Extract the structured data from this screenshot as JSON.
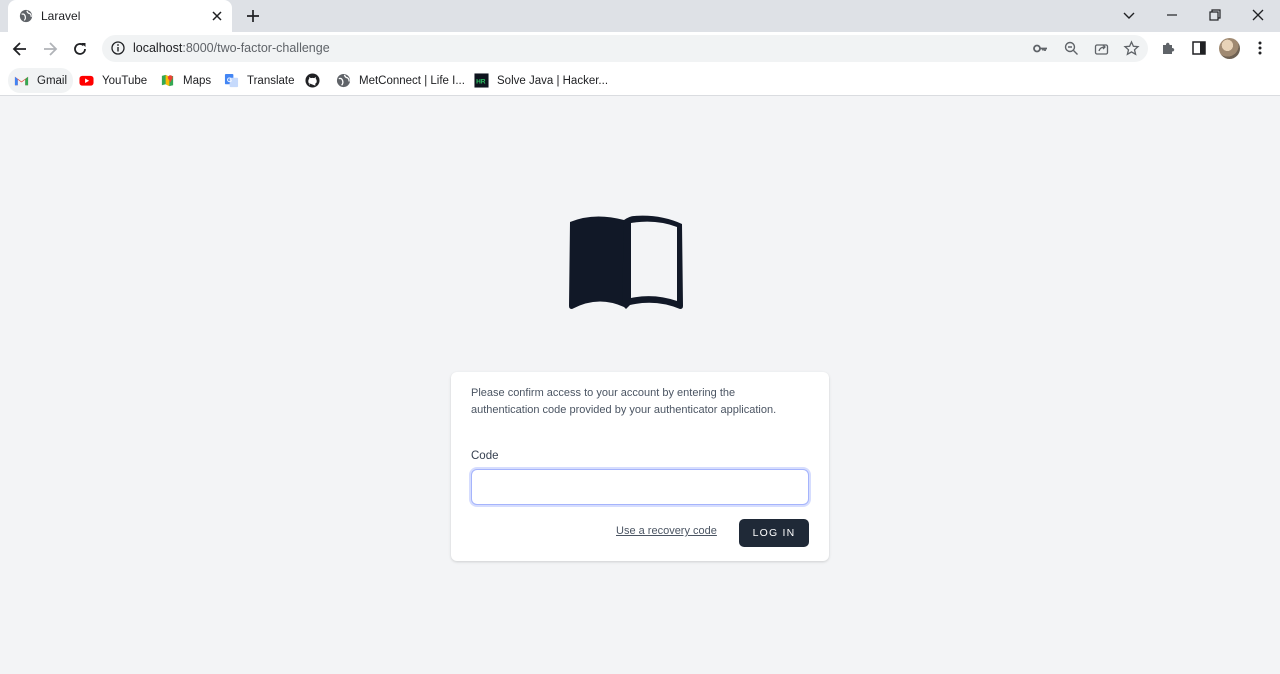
{
  "browser": {
    "tab": {
      "title": "Laravel",
      "favicon": "globe-icon"
    },
    "address_bar": {
      "host": "localhost",
      "rest": ":8000/two-factor-challenge"
    },
    "bookmarks": [
      {
        "label": "Gmail",
        "icon": "gmail-icon"
      },
      {
        "label": "YouTube",
        "icon": "youtube-icon"
      },
      {
        "label": "Maps",
        "icon": "maps-icon"
      },
      {
        "label": "Translate",
        "icon": "translate-icon"
      },
      {
        "label": "",
        "icon": "github-icon"
      },
      {
        "label": "MetConnect | Life I...",
        "icon": "globe-icon"
      },
      {
        "label": "Solve Java | Hacker...",
        "icon": "hackerrank-icon"
      }
    ]
  },
  "page": {
    "logo": "open-book-icon",
    "message": "Please confirm access to your account by entering the authentication code provided by your authenticator application.",
    "code_label": "Code",
    "code_value": "",
    "recovery_link": "Use a recovery code",
    "login_button": "LOG IN"
  },
  "colors": {
    "page_background": "#f3f4f6",
    "button": "#1f2937",
    "logo": "#111827",
    "input_focus": "#a5b4fc"
  }
}
